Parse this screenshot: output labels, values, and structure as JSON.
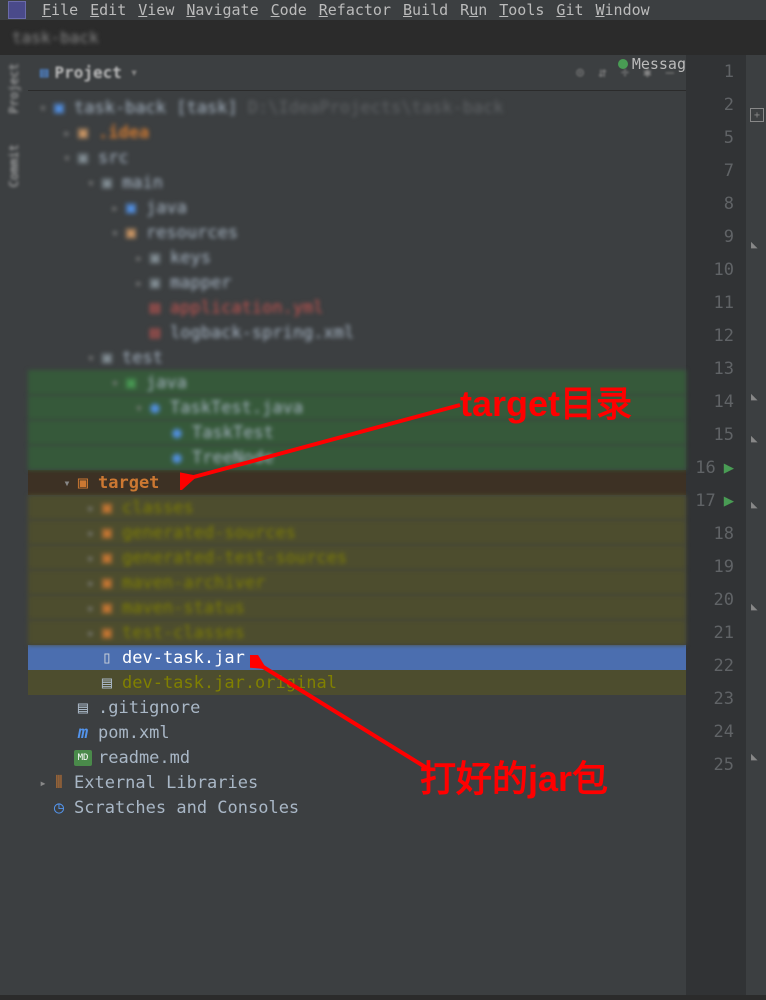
{
  "menubar": {
    "items": [
      "File",
      "Edit",
      "View",
      "Navigate",
      "Code",
      "Refactor",
      "Build",
      "Run",
      "Tools",
      "Git",
      "Window"
    ]
  },
  "breadcrumb": "task-back",
  "sidebar": {
    "items": [
      "Project",
      "Commit"
    ]
  },
  "projectPanel": {
    "title": "Project"
  },
  "messagesTab": "Messag",
  "tree": {
    "root": {
      "name": "task-back [task]",
      "path": "D:\\IdeaProjects\\task-back"
    },
    "idea": ".idea",
    "src": "src",
    "main": "main",
    "java1": "java",
    "resources": "resources",
    "keys": "keys",
    "mapper": "mapper",
    "appyml": "application.yml",
    "logback": "logback-spring.xml",
    "test": "test",
    "java2": "java",
    "tasktest": "TaskTest.java",
    "tasktestClass": "TaskTest",
    "treeNode": "TreeNode",
    "target": "target",
    "classes": "classes",
    "genSources": "generated-sources",
    "genTestSources": "generated-test-sources",
    "mavenArchiver": "maven-archiver",
    "mavenStatus": "maven-status",
    "testClasses": "test-classes",
    "devJar": "dev-task.jar",
    "devJarOrig": "dev-task.jar.original",
    "gitignore": ".gitignore",
    "pom": "pom.xml",
    "readme": "readme.md",
    "extLibs": "External Libraries",
    "scratches": "Scratches and Consoles"
  },
  "lineNumbers": [
    1,
    2,
    5,
    7,
    8,
    9,
    10,
    11,
    12,
    13,
    14,
    15,
    16,
    17,
    18,
    19,
    20,
    21,
    22,
    23,
    24,
    25
  ],
  "runnableLines": [
    16,
    17
  ],
  "annotations": {
    "target": "target目录",
    "jar": "打好的jar包"
  }
}
